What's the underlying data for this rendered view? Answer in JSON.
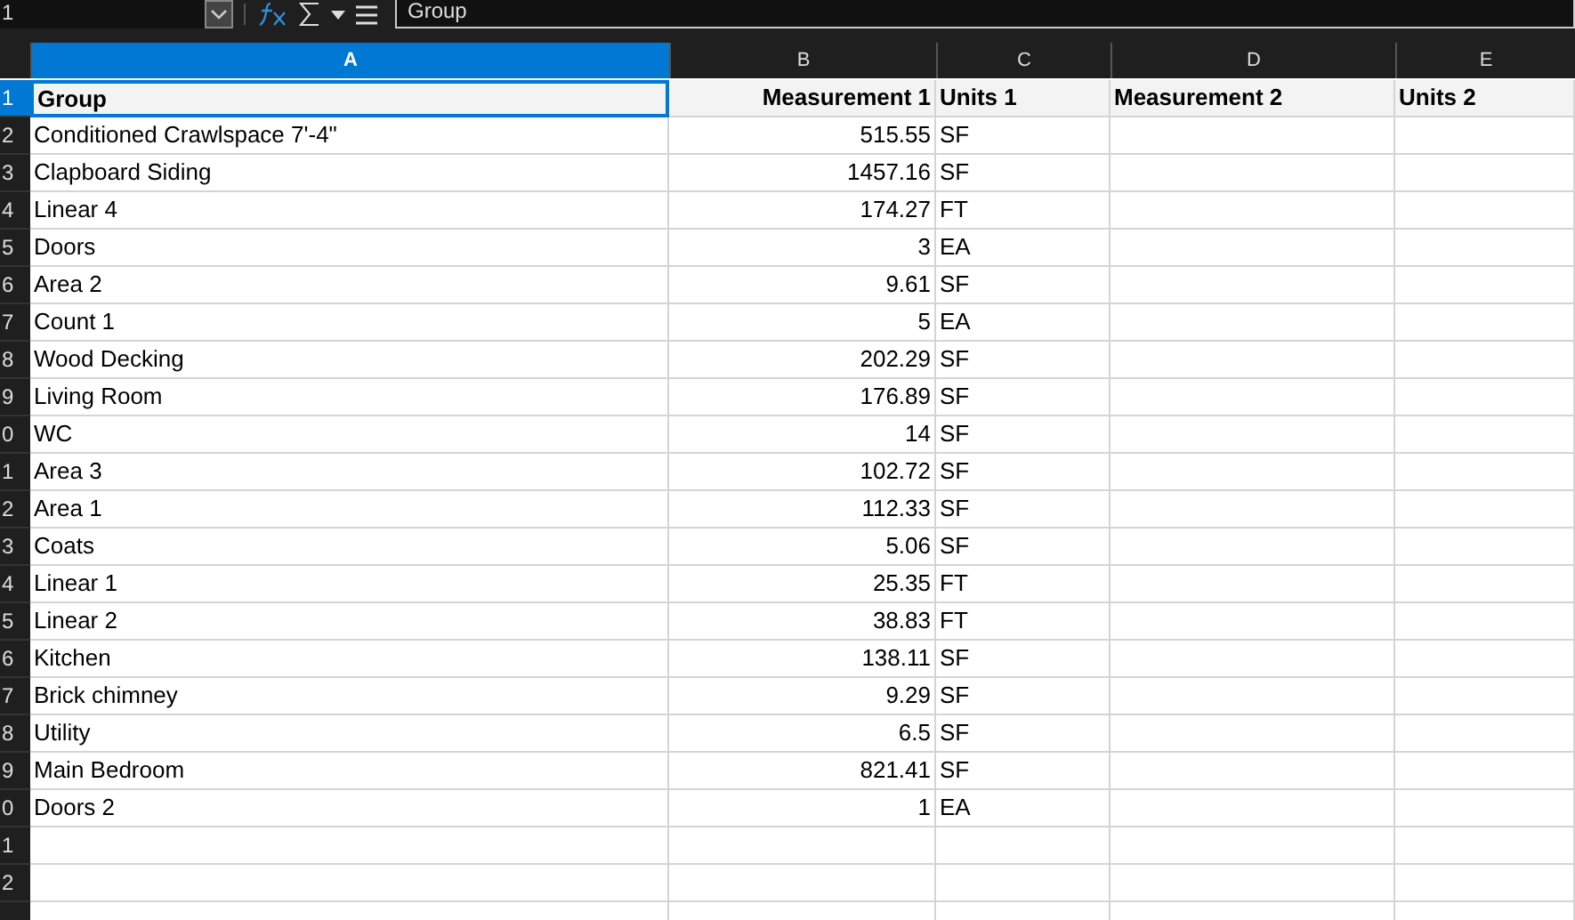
{
  "name_box": {
    "value": "1"
  },
  "formula_bar": {
    "value": "Group"
  },
  "columns": [
    {
      "label": "A",
      "selected": true,
      "kind": "text"
    },
    {
      "label": "B",
      "selected": false,
      "kind": "number"
    },
    {
      "label": "C",
      "selected": false,
      "kind": "text"
    },
    {
      "label": "D",
      "selected": false,
      "kind": "text"
    },
    {
      "label": "E",
      "selected": false,
      "kind": "text"
    }
  ],
  "rows": [
    {
      "header": "1",
      "selected": true,
      "kind": "header",
      "cells": [
        "Group",
        "Measurement 1",
        "Units 1",
        "Measurement 2",
        "Units 2"
      ]
    },
    {
      "header": "2",
      "selected": false,
      "kind": "data",
      "cells": [
        "Conditioned Crawlspace 7'-4\"",
        "515.55",
        "SF",
        null,
        null
      ]
    },
    {
      "header": "3",
      "selected": false,
      "kind": "data",
      "cells": [
        "Clapboard Siding",
        "1457.16",
        "SF",
        null,
        null
      ]
    },
    {
      "header": "4",
      "selected": false,
      "kind": "data",
      "cells": [
        "Linear 4",
        "174.27",
        "FT",
        null,
        null
      ]
    },
    {
      "header": "5",
      "selected": false,
      "kind": "data",
      "cells": [
        "Doors",
        "3",
        "EA",
        null,
        null
      ]
    },
    {
      "header": "6",
      "selected": false,
      "kind": "data",
      "cells": [
        "Area 2",
        "9.61",
        "SF",
        null,
        null
      ]
    },
    {
      "header": "7",
      "selected": false,
      "kind": "data",
      "cells": [
        "Count 1",
        "5",
        "EA",
        null,
        null
      ]
    },
    {
      "header": "8",
      "selected": false,
      "kind": "data",
      "cells": [
        "Wood Decking",
        "202.29",
        "SF",
        null,
        null
      ]
    },
    {
      "header": "9",
      "selected": false,
      "kind": "data",
      "cells": [
        "Living Room",
        "176.89",
        "SF",
        null,
        null
      ]
    },
    {
      "header": "0",
      "selected": false,
      "kind": "data",
      "cells": [
        "WC",
        "14",
        "SF",
        null,
        null
      ]
    },
    {
      "header": "1",
      "selected": false,
      "kind": "data",
      "cells": [
        "Area 3",
        "102.72",
        "SF",
        null,
        null
      ]
    },
    {
      "header": "2",
      "selected": false,
      "kind": "data",
      "cells": [
        "Area 1",
        "112.33",
        "SF",
        null,
        null
      ]
    },
    {
      "header": "3",
      "selected": false,
      "kind": "data",
      "cells": [
        "Coats",
        "5.06",
        "SF",
        null,
        null
      ]
    },
    {
      "header": "4",
      "selected": false,
      "kind": "data",
      "cells": [
        "Linear 1",
        "25.35",
        "FT",
        null,
        null
      ]
    },
    {
      "header": "5",
      "selected": false,
      "kind": "data",
      "cells": [
        "Linear 2",
        "38.83",
        "FT",
        null,
        null
      ]
    },
    {
      "header": "6",
      "selected": false,
      "kind": "data",
      "cells": [
        "Kitchen",
        "138.11",
        "SF",
        null,
        null
      ]
    },
    {
      "header": "7",
      "selected": false,
      "kind": "data",
      "cells": [
        "Brick chimney",
        "9.29",
        "SF",
        null,
        null
      ]
    },
    {
      "header": "8",
      "selected": false,
      "kind": "data",
      "cells": [
        "Utility",
        "6.5",
        "SF",
        null,
        null
      ]
    },
    {
      "header": "9",
      "selected": false,
      "kind": "data",
      "cells": [
        "Main Bedroom",
        "821.41",
        "SF",
        null,
        null
      ]
    },
    {
      "header": "0",
      "selected": false,
      "kind": "data",
      "cells": [
        "Doors 2",
        "1",
        "EA",
        null,
        null
      ]
    },
    {
      "header": "1",
      "selected": false,
      "kind": "data"
    },
    {
      "header": "2",
      "selected": false,
      "kind": "data"
    }
  ]
}
